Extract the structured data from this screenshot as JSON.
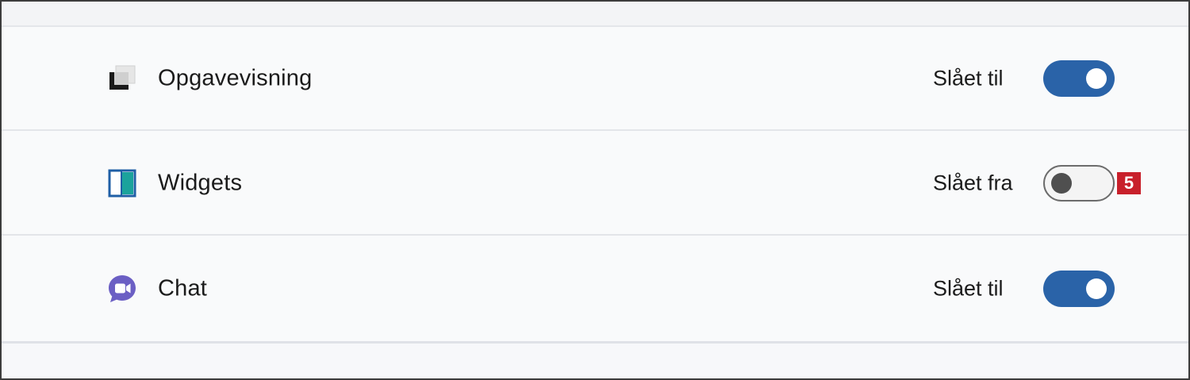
{
  "settings": {
    "rows": [
      {
        "label": "Opgavevisning",
        "icon": "task-view-icon",
        "state_text": "Slået til",
        "toggle": "on"
      },
      {
        "label": "Widgets",
        "icon": "widgets-icon",
        "state_text": "Slået fra",
        "toggle": "off",
        "badge": "5"
      },
      {
        "label": "Chat",
        "icon": "chat-icon",
        "state_text": "Slået til",
        "toggle": "on"
      }
    ]
  },
  "colors": {
    "toggle_on": "#2a63a8",
    "toggle_off_knob": "#4f4f4f",
    "badge": "#c8202b",
    "chat_icon": "#6b5fc4"
  }
}
